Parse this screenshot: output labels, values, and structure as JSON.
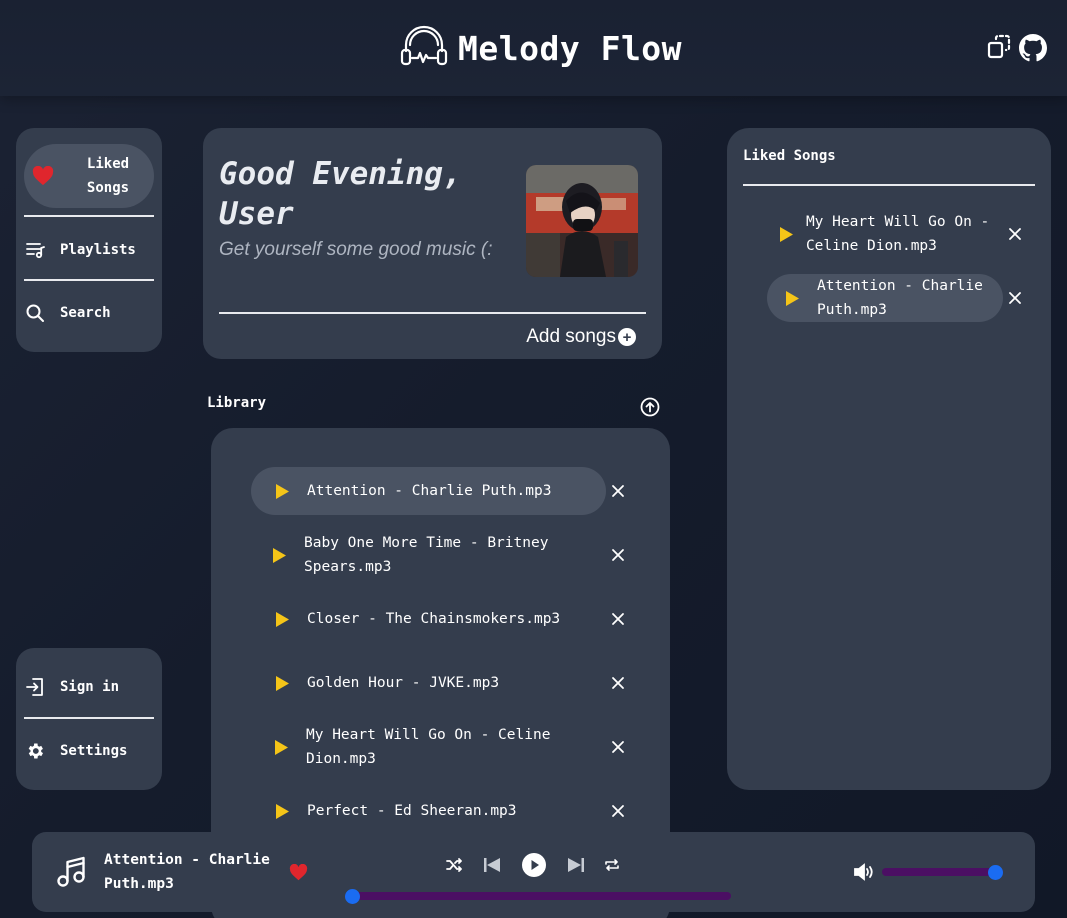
{
  "app": {
    "title": "Melody Flow"
  },
  "nav": {
    "liked_label": "Liked Songs",
    "playlists_label": "Playlists",
    "search_label": "Search",
    "signin_label": "Sign in",
    "settings_label": "Settings"
  },
  "greeting": {
    "title": "Good Evening, User",
    "subtitle": "Get yourself some good music (:",
    "add_songs_label": "Add songs"
  },
  "library": {
    "label": "Library",
    "songs": [
      {
        "title": "Attention - Charlie Puth.mp3",
        "active": true
      },
      {
        "title": "Baby One More Time - Britney Spears.mp3",
        "active": false
      },
      {
        "title": "Closer - The Chainsmokers.mp3",
        "active": false
      },
      {
        "title": "Golden Hour - JVKE.mp3",
        "active": false
      },
      {
        "title": "My Heart Will Go On - Celine Dion.mp3",
        "active": false
      },
      {
        "title": "Perfect - Ed Sheeran.mp3",
        "active": false
      }
    ]
  },
  "liked_songs": {
    "label": "Liked Songs",
    "songs": [
      {
        "title": "My Heart Will Go On - Celine Dion.mp3",
        "active": false
      },
      {
        "title": "Attention - Charlie Puth.mp3",
        "active": true
      }
    ]
  },
  "player": {
    "now_playing": "Attention - Charlie Puth.mp3",
    "liked": true,
    "progress": 0,
    "volume": 1.0
  },
  "colors": {
    "accent_play": "#f5c518",
    "heart": "#e0262d",
    "slider_thumb": "#1a6cf2",
    "slider_track": "#4b0f63",
    "panel": "#343d4d",
    "active_pill": "#4a5363"
  },
  "icons": {
    "brand": "headphones-icon",
    "header_right": [
      "copy-icon",
      "github-icon"
    ]
  }
}
